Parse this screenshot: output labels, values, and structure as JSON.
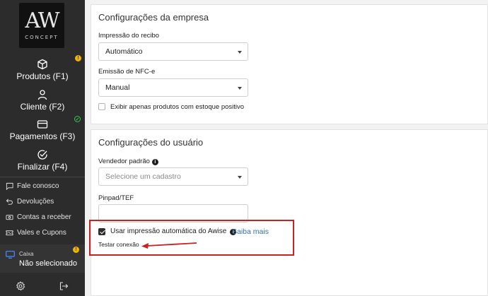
{
  "brand": {
    "logo_mark": "AW",
    "logo_sub": "CONCEPT"
  },
  "sidebar": {
    "main_items": [
      {
        "label": "Produtos (F1)",
        "icon": "box-icon",
        "badge": "!"
      },
      {
        "label": "Cliente (F2)",
        "icon": "user-icon"
      },
      {
        "label": "Pagamentos (F3)",
        "icon": "credit-card-icon",
        "badge": "check"
      },
      {
        "label": "Finalizar (F4)",
        "icon": "check-circle-icon"
      }
    ],
    "sub_items": [
      {
        "label": "Fale conosco",
        "icon": "chat-icon"
      },
      {
        "label": "Devoluções",
        "icon": "return-icon"
      },
      {
        "label": "Contas a receber",
        "icon": "money-icon"
      },
      {
        "label": "Vales e Cupons",
        "icon": "ticket-icon"
      }
    ],
    "caixa": {
      "title": "Caixa",
      "value": "Não selecionado",
      "badge": "!"
    },
    "bottom": {
      "settings_icon": "gear-icon",
      "logout_icon": "logout-icon"
    }
  },
  "company_settings": {
    "title": "Configurações da empresa",
    "receipt_label": "Impressão do recibo",
    "receipt_value": "Automático",
    "nfce_label": "Emissão de NFC-e",
    "nfce_value": "Manual",
    "stock_only_label": "Exibir apenas produtos com estoque positivo",
    "stock_only_checked": false
  },
  "user_settings": {
    "title": "Configurações do usuário",
    "seller_label": "Vendedor padrão",
    "seller_placeholder": "Selecione um cadastro",
    "pinpad_label": "Pinpad/TEF",
    "pinpad_value": "",
    "auto_print_label": "Usar impressão automática do Awise",
    "auto_print_checked": true,
    "learn_more": "Saiba mais",
    "test_connection": "Testar conexão"
  },
  "colors": {
    "sidebar_bg": "#2c2c2c",
    "highlight": "#cc1f1f",
    "link": "#2f6fb0",
    "warning": "#f0b400",
    "success": "#2fc74b"
  }
}
